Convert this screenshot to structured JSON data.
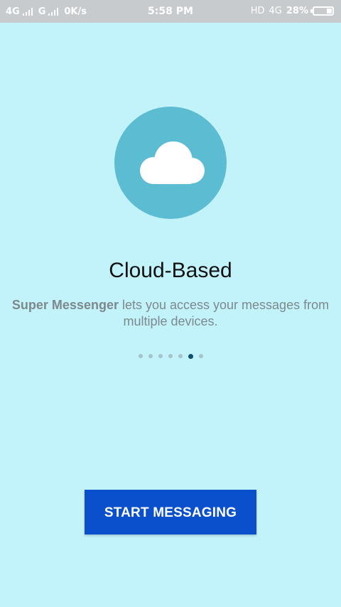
{
  "status_bar": {
    "net1": "4G",
    "net2": "G",
    "speed": "0K/s",
    "time": "5:58 PM",
    "hd": "HD",
    "net3": "4G",
    "battery_percent": "28%",
    "battery_level": 0.28,
    "icons": [
      "signal-strength-icon",
      "battery-icon"
    ]
  },
  "onboarding": {
    "illustration_icon": "cloud-icon",
    "title": "Cloud-Based",
    "brand": "Super Messenger",
    "description_rest": " lets you access your messages from multiple devices.",
    "page_count": 7,
    "active_page": 6
  },
  "button": {
    "label": "START MESSAGING"
  },
  "colors": {
    "background": "#c2f3fb",
    "circle": "#5cbcd2",
    "button": "#0a50cc",
    "active_dot": "#0d4f6c"
  }
}
